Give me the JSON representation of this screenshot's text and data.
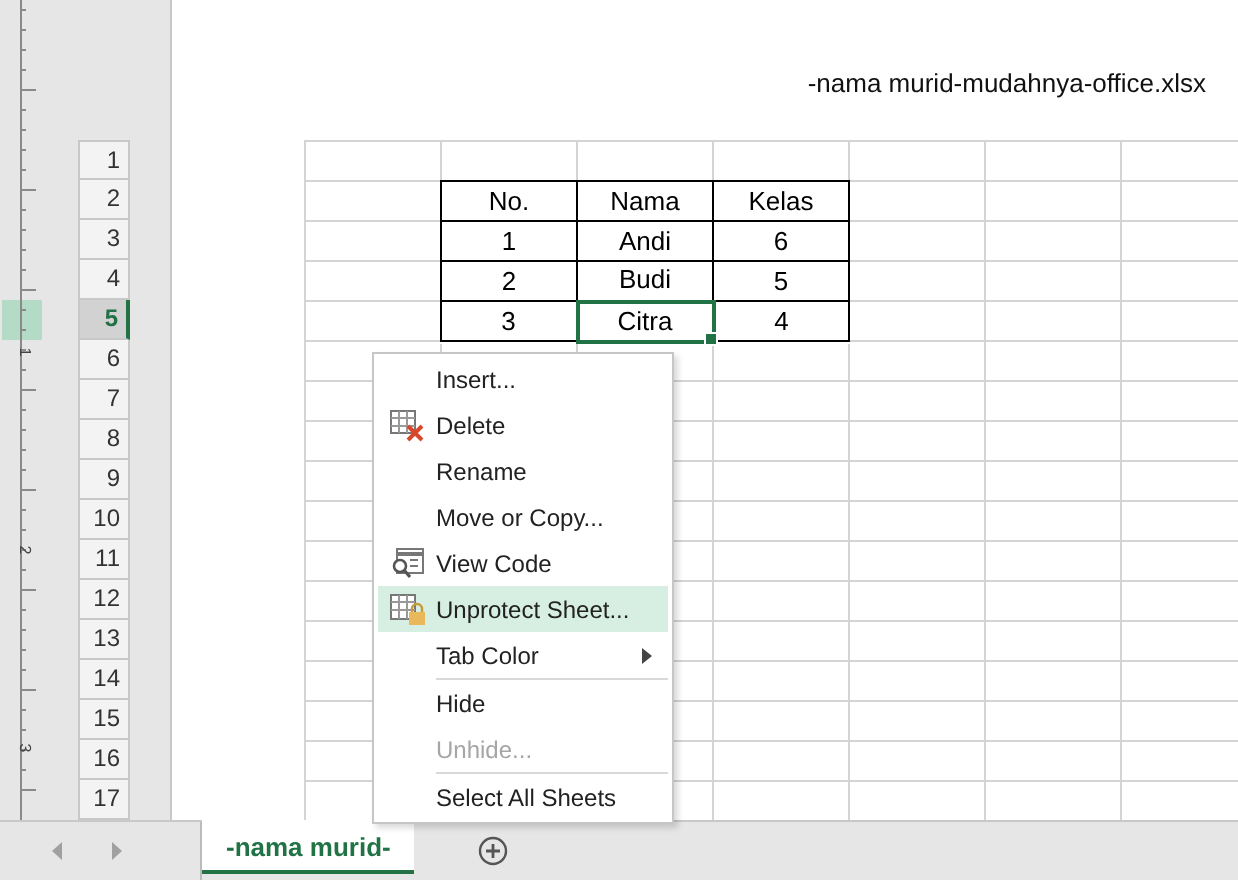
{
  "document": {
    "header": "-nama murid-mudahnya-office.xlsx"
  },
  "ruler": {
    "labels": [
      "1",
      "2",
      "3"
    ]
  },
  "row_headers": [
    {
      "label": "1",
      "selected": false
    },
    {
      "label": "2",
      "selected": false
    },
    {
      "label": "3",
      "selected": false
    },
    {
      "label": "4",
      "selected": false
    },
    {
      "label": "5",
      "selected": true
    },
    {
      "label": "6",
      "selected": false
    },
    {
      "label": "7",
      "selected": false
    },
    {
      "label": "8",
      "selected": false
    },
    {
      "label": "9",
      "selected": false
    },
    {
      "label": "10",
      "selected": false
    },
    {
      "label": "11",
      "selected": false
    },
    {
      "label": "12",
      "selected": false
    },
    {
      "label": "13",
      "selected": false
    },
    {
      "label": "14",
      "selected": false
    },
    {
      "label": "15",
      "selected": false
    },
    {
      "label": "16",
      "selected": false
    },
    {
      "label": "17",
      "selected": false
    }
  ],
  "table": {
    "columns": [
      "No.",
      "Nama",
      "Kelas"
    ],
    "rows": [
      [
        {
          "text": "1",
          "selected": false
        },
        {
          "text": "Andi",
          "selected": false
        },
        {
          "text": "6",
          "selected": false
        }
      ],
      [
        {
          "text": "2",
          "selected": false
        },
        {
          "text": "Budi",
          "selected": false
        },
        {
          "text": "5",
          "selected": false
        }
      ],
      [
        {
          "text": "3",
          "selected": false
        },
        {
          "text": "Citra",
          "selected": true
        },
        {
          "text": "4",
          "selected": false
        }
      ]
    ]
  },
  "context_menu": {
    "items": [
      {
        "kind": "item",
        "label": "Insert...",
        "selected": false,
        "disabled": false,
        "submenu": false
      },
      {
        "kind": "item",
        "label": "Delete",
        "selected": false,
        "disabled": false,
        "submenu": false
      },
      {
        "kind": "item",
        "label": "Rename",
        "selected": false,
        "disabled": false,
        "submenu": false
      },
      {
        "kind": "item",
        "label": "Move or Copy...",
        "selected": false,
        "disabled": false,
        "submenu": false
      },
      {
        "kind": "item",
        "label": "View Code",
        "selected": false,
        "disabled": false,
        "submenu": false
      },
      {
        "kind": "item",
        "label": "Unprotect Sheet...",
        "selected": true,
        "disabled": false,
        "submenu": false
      },
      {
        "kind": "item",
        "label": "Tab Color",
        "selected": false,
        "disabled": false,
        "submenu": true
      },
      {
        "kind": "separator"
      },
      {
        "kind": "item",
        "label": "Hide",
        "selected": false,
        "disabled": false,
        "submenu": false
      },
      {
        "kind": "item",
        "label": "Unhide...",
        "selected": false,
        "disabled": true,
        "submenu": false
      },
      {
        "kind": "separator"
      },
      {
        "kind": "item",
        "label": "Select All Sheets",
        "selected": false,
        "disabled": false,
        "submenu": false
      }
    ]
  },
  "sheet_tabs": [
    {
      "label": "-nama murid-",
      "selected": true
    }
  ]
}
